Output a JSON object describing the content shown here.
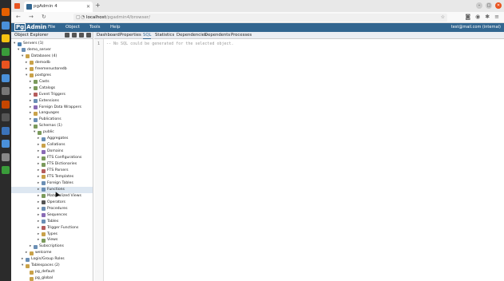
{
  "browser": {
    "tab_title": "pgAdmin 4",
    "url_host": "localhost",
    "url_path": "/pgadmin4/browser/"
  },
  "pgadmin": {
    "logo_pg": "Pg",
    "logo_rest": "Admin",
    "menus": [
      "File",
      "Object",
      "Tools",
      "Help"
    ],
    "user": "test@mail.com (internal)"
  },
  "explorer": {
    "title": "Object Explorer",
    "tree": [
      {
        "label": "Servers (1)",
        "depth": 0,
        "chev": "v",
        "icon": "#4a7fb0"
      },
      {
        "label": "demo_server",
        "depth": 1,
        "chev": "v",
        "icon": "#6b8fb5"
      },
      {
        "label": "Databases (4)",
        "depth": 2,
        "chev": "v",
        "icon": "#c9a24a"
      },
      {
        "label": "demodb",
        "depth": 3,
        "chev": ">",
        "icon": "#c9a24a"
      },
      {
        "label": "freemenustoredb",
        "depth": 3,
        "chev": ">",
        "icon": "#c9a24a"
      },
      {
        "label": "postgres",
        "depth": 3,
        "chev": "v",
        "icon": "#c9a24a"
      },
      {
        "label": "Casts",
        "depth": 4,
        "chev": ">",
        "icon": "#7b9a5c"
      },
      {
        "label": "Catalogs",
        "depth": 4,
        "chev": ">",
        "icon": "#7b9a5c"
      },
      {
        "label": "Event Triggers",
        "depth": 4,
        "chev": ">",
        "icon": "#b55c5c"
      },
      {
        "label": "Extensions",
        "depth": 4,
        "chev": ">",
        "icon": "#6b8fb5"
      },
      {
        "label": "Foreign Data Wrappers",
        "depth": 4,
        "chev": ">",
        "icon": "#8a6bb5"
      },
      {
        "label": "Languages",
        "depth": 4,
        "chev": ">",
        "icon": "#c9a24a"
      },
      {
        "label": "Publications",
        "depth": 4,
        "chev": ">",
        "icon": "#6b8fb5"
      },
      {
        "label": "Schemas (1)",
        "depth": 4,
        "chev": "v",
        "icon": "#7b9a5c"
      },
      {
        "label": "public",
        "depth": 5,
        "chev": "v",
        "icon": "#7b9a5c"
      },
      {
        "label": "Aggregates",
        "depth": 6,
        "chev": ">",
        "icon": "#6b8fb5"
      },
      {
        "label": "Collations",
        "depth": 6,
        "chev": ">",
        "icon": "#c9a24a"
      },
      {
        "label": "Domains",
        "depth": 6,
        "chev": ">",
        "icon": "#8a6bb5"
      },
      {
        "label": "FTS Configurations",
        "depth": 6,
        "chev": ">",
        "icon": "#7b9a5c"
      },
      {
        "label": "FTS Dictionaries",
        "depth": 6,
        "chev": ">",
        "icon": "#7b9a5c"
      },
      {
        "label": "FTS Parsers",
        "depth": 6,
        "chev": ">",
        "icon": "#b55c5c"
      },
      {
        "label": "FTS Templates",
        "depth": 6,
        "chev": ">",
        "icon": "#c9a24a"
      },
      {
        "label": "Foreign Tables",
        "depth": 6,
        "chev": ">",
        "icon": "#6b8fb5"
      },
      {
        "label": "Functions",
        "depth": 6,
        "chev": ">",
        "icon": "#6b8fb5",
        "selected": true
      },
      {
        "label": "Materialized Views",
        "depth": 6,
        "chev": ">",
        "icon": "#7b9a5c"
      },
      {
        "label": "Operators",
        "depth": 6,
        "chev": ">",
        "icon": "#555555"
      },
      {
        "label": "Procedures",
        "depth": 6,
        "chev": ">",
        "icon": "#6b8fb5"
      },
      {
        "label": "Sequences",
        "depth": 6,
        "chev": ">",
        "icon": "#8a6bb5"
      },
      {
        "label": "Tables",
        "depth": 6,
        "chev": ">",
        "icon": "#6b8fb5"
      },
      {
        "label": "Trigger Functions",
        "depth": 6,
        "chev": ">",
        "icon": "#b55c5c"
      },
      {
        "label": "Types",
        "depth": 6,
        "chev": ">",
        "icon": "#c9a24a"
      },
      {
        "label": "Views",
        "depth": 6,
        "chev": ">",
        "icon": "#7b9a5c"
      },
      {
        "label": "Subscriptions",
        "depth": 4,
        "chev": ">",
        "icon": "#6b8fb5"
      },
      {
        "label": "welcome",
        "depth": 3,
        "chev": ">",
        "icon": "#c9a24a"
      },
      {
        "label": "Login/Group Roles",
        "depth": 2,
        "chev": ">",
        "icon": "#6b8fb5"
      },
      {
        "label": "Tablespaces (2)",
        "depth": 2,
        "chev": "v",
        "icon": "#c9a24a"
      },
      {
        "label": "pg_default",
        "depth": 3,
        "chev": "",
        "icon": "#c9a24a"
      },
      {
        "label": "pg_global",
        "depth": 3,
        "chev": "",
        "icon": "#c9a24a"
      }
    ]
  },
  "panel": {
    "tabs": [
      "Dashboard",
      "Properties",
      "SQL",
      "Statistics",
      "Dependencies",
      "Dependents",
      "Processes"
    ],
    "active_tab": "SQL",
    "line_number": "1",
    "sql_text": "-- No SQL could be generated for the selected object."
  },
  "colors": {
    "brand": "#326690",
    "dock": "#2b2b2b",
    "ubuntu_orange": "#e95420"
  }
}
